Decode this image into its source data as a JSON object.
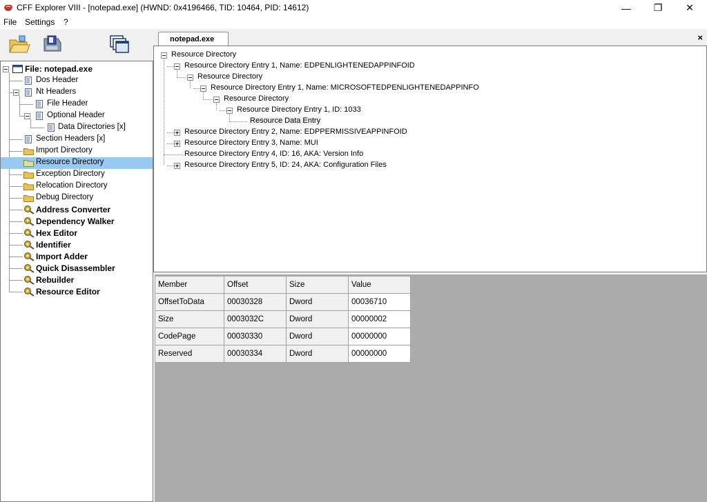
{
  "window": {
    "title": "CFF Explorer VIII - [notepad.exe] (HWND: 0x4196466, TID: 10464, PID: 14612)",
    "controls": {
      "minimize": "—",
      "maximize": "❐",
      "close": "✕"
    }
  },
  "menu": {
    "items": [
      "File",
      "Settings",
      "?"
    ]
  },
  "toolbar": {
    "buttons": [
      "open-folder-icon",
      "save-disk-icon",
      "windows-icon"
    ]
  },
  "tabs": {
    "active": "notepad.exe",
    "close": "×"
  },
  "left_tree": {
    "items": [
      {
        "label": "File: notepad.exe"
      },
      {
        "label": "Dos Header"
      },
      {
        "label": "Nt Headers"
      },
      {
        "label": "File Header"
      },
      {
        "label": "Optional Header"
      },
      {
        "label": "Data Directories [x]"
      },
      {
        "label": "Section Headers [x]"
      },
      {
        "label": "Import Directory"
      },
      {
        "label": "Resource Directory"
      },
      {
        "label": "Exception Directory"
      },
      {
        "label": "Relocation Directory"
      },
      {
        "label": "Debug Directory"
      },
      {
        "label": "Address Converter"
      },
      {
        "label": "Dependency Walker"
      },
      {
        "label": "Hex Editor"
      },
      {
        "label": "Identifier"
      },
      {
        "label": "Import Adder"
      },
      {
        "label": "Quick Disassembler"
      },
      {
        "label": "Rebuilder"
      },
      {
        "label": "Resource Editor"
      }
    ],
    "selected": "Resource Directory"
  },
  "resource_tree": {
    "items": [
      {
        "label": "Resource Directory"
      },
      {
        "label": "Resource Directory Entry 1, Name: EDPENLIGHTENEDAPPINFOID"
      },
      {
        "label": "Resource Directory"
      },
      {
        "label": "Resource Directory Entry 1, Name: MICROSOFTEDPENLIGHTENEDAPPINFO"
      },
      {
        "label": "Resource Directory"
      },
      {
        "label": "Resource Directory Entry 1, ID: 1033"
      },
      {
        "label": "Resource Data Entry"
      },
      {
        "label": "Resource Directory Entry 2, Name: EDPPERMISSIVEAPPINFOID"
      },
      {
        "label": "Resource Directory Entry 3, Name: MUI"
      },
      {
        "label": "Resource Directory Entry 4, ID: 16, AKA: Version Info"
      },
      {
        "label": "Resource Directory Entry 5, ID: 24, AKA: Configuration Files"
      }
    ],
    "selected": "Resource Data Entry"
  },
  "grid": {
    "headers": [
      "Member",
      "Offset",
      "Size",
      "Value"
    ],
    "rows": [
      [
        "OffsetToData",
        "00030328",
        "Dword",
        "00036710"
      ],
      [
        "Size",
        "0003032C",
        "Dword",
        "00000002"
      ],
      [
        "CodePage",
        "00030330",
        "Dword",
        "00000000"
      ],
      [
        "Reserved",
        "00030334",
        "Dword",
        "00000000"
      ]
    ]
  },
  "colors": {
    "selection": "#99c9ef",
    "grid_background": "#ababab",
    "folder": "#e8c35a",
    "tool_icon": "#c9a227"
  }
}
